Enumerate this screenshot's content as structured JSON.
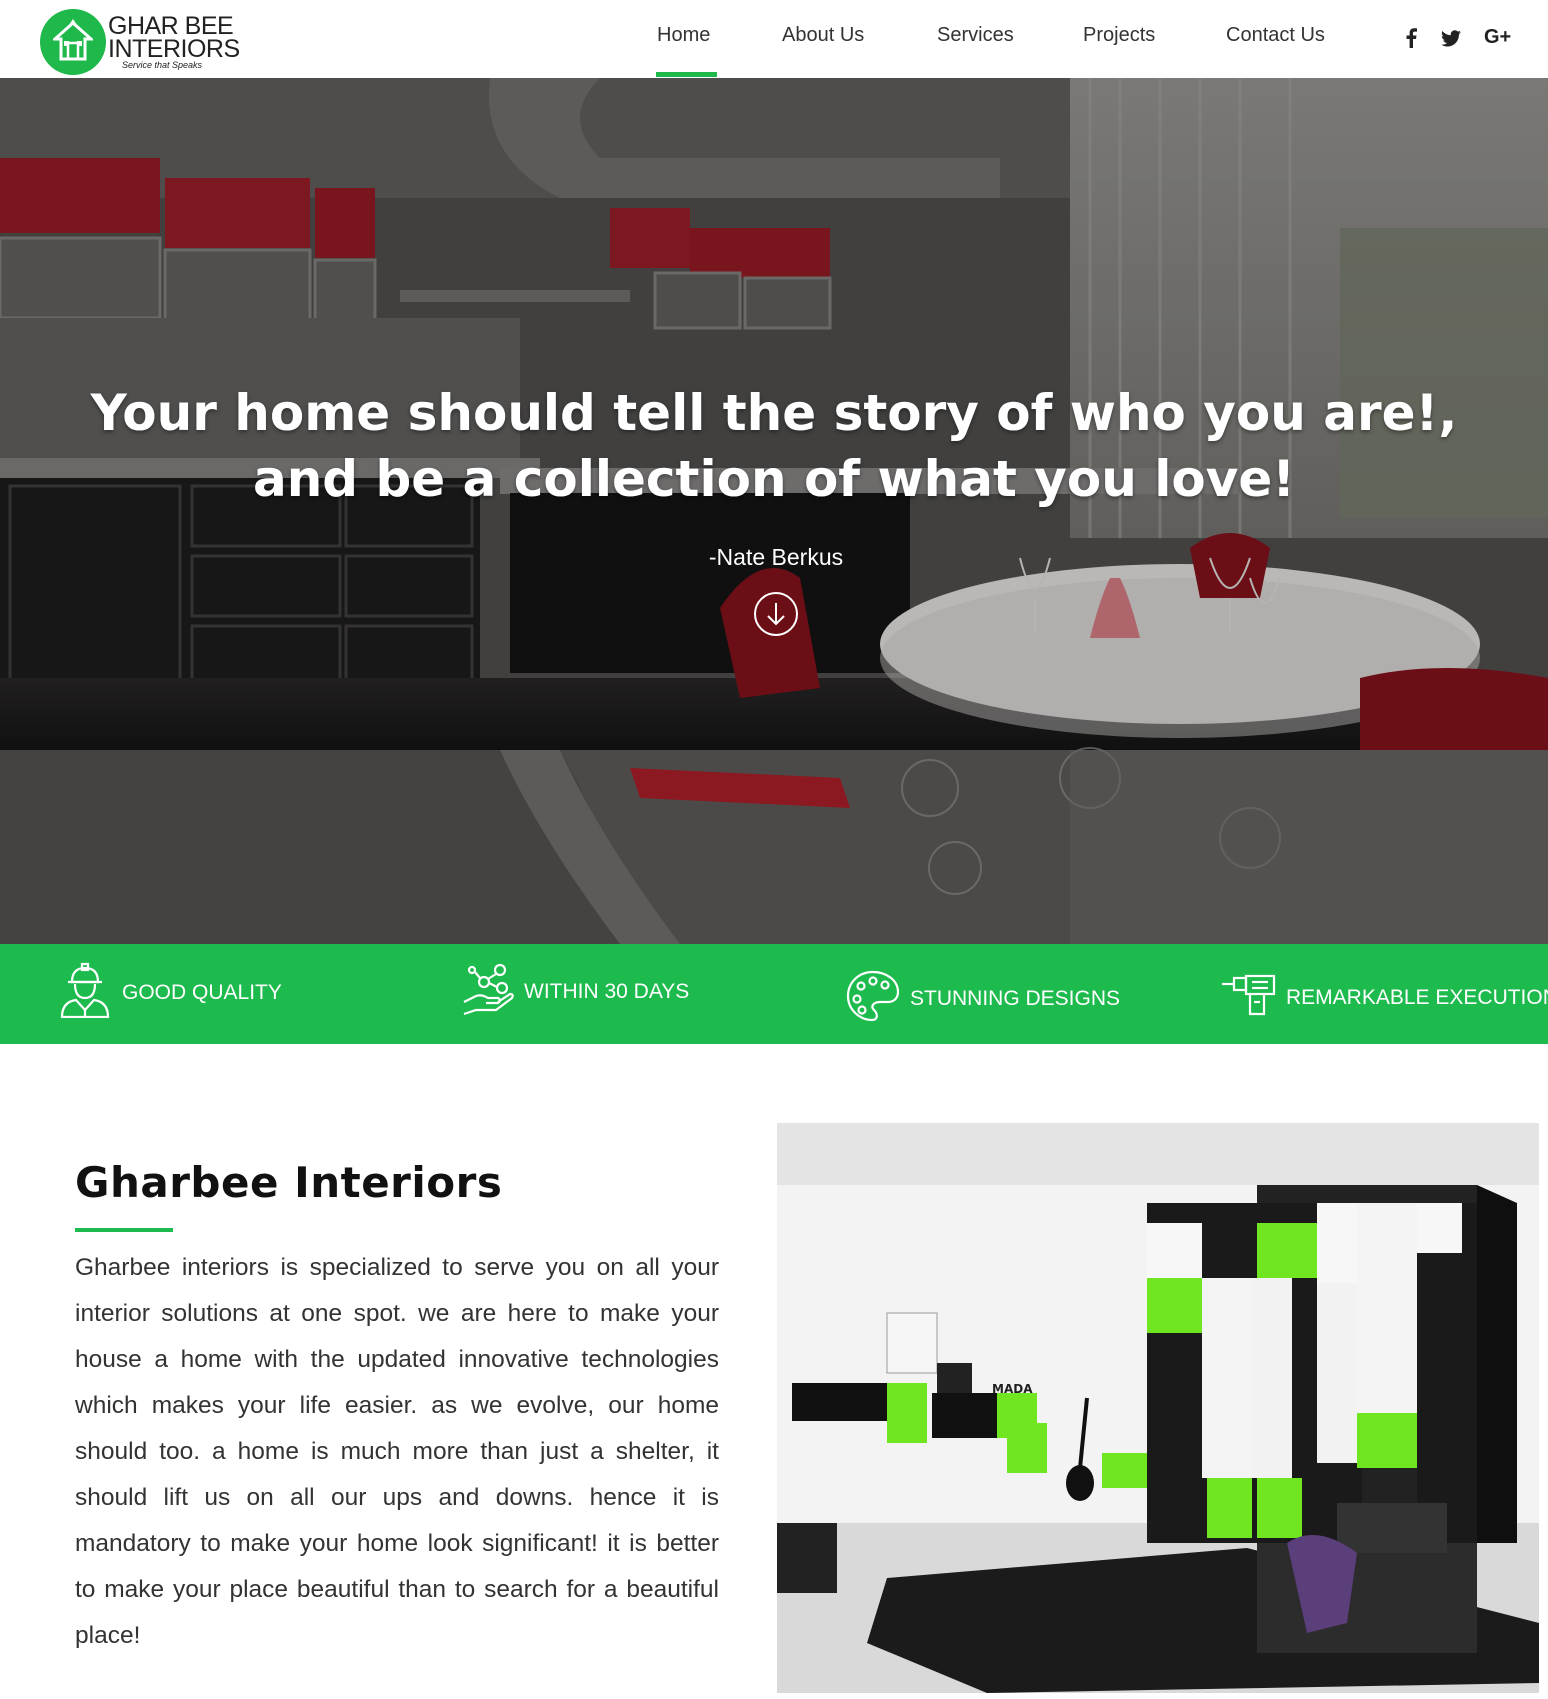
{
  "brand": {
    "name_line1": "GHAR BEE",
    "name_line2": "INTERIORS",
    "tagline": "Service that Speaks",
    "color": "#1fb84a"
  },
  "nav": {
    "items": [
      {
        "label": "Home",
        "active": true
      },
      {
        "label": "About Us"
      },
      {
        "label": "Services"
      },
      {
        "label": "Projects"
      },
      {
        "label": "Contact Us"
      }
    ],
    "social": [
      "facebook-icon",
      "twitter-icon",
      "google-plus-icon"
    ],
    "google_plus_label": "G+"
  },
  "hero": {
    "quote": "Your home should tell the story of who you are!, and be a collection of what you love!",
    "author": "-Nate Berkus",
    "scroll_icon": "arrow-down-circle-icon"
  },
  "features": [
    {
      "icon": "worker-icon",
      "label": "GOOD QUALITY"
    },
    {
      "icon": "hand-molecule-icon",
      "label": "WITHIN 30 DAYS"
    },
    {
      "icon": "palette-icon",
      "label": "STUNNING DESIGNS"
    },
    {
      "icon": "drill-icon",
      "label": "REMARKABLE EXECUTION"
    }
  ],
  "about": {
    "title": "Gharbee Interiors",
    "text": "Gharbee interiors is specialized to serve you on all your interior solutions at one spot. we are here to make your house a home with the updated innovative technologies which makes your life easier. as we evolve, our home should too. a home is much more than just a shelter, it should lift us on all our ups and downs. hence it is mandatory to make your home look significant! it is better to make your place beautiful than to search for a beautiful place!",
    "shelf_label": "MADA"
  },
  "colors": {
    "accent": "#1dba4d",
    "hero_red": "#c41c2c"
  }
}
